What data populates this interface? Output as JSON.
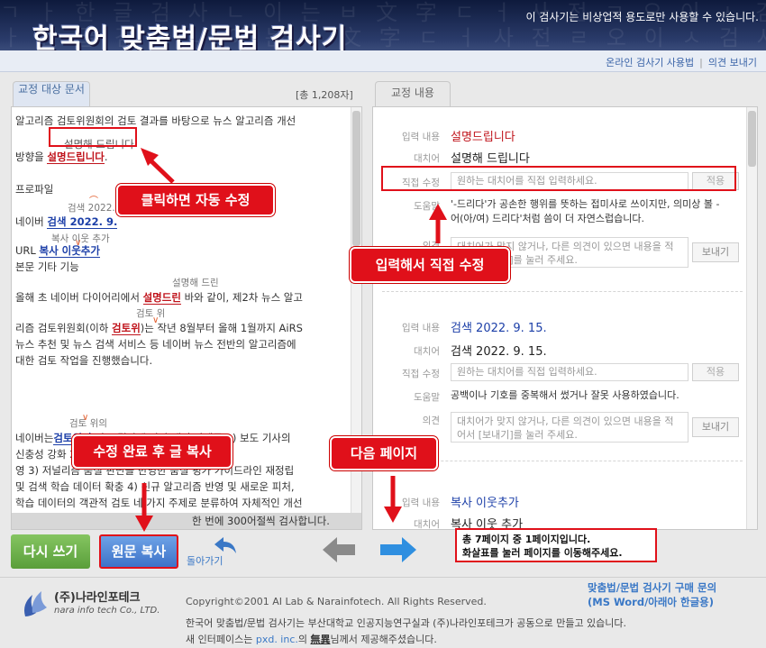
{
  "header": {
    "pattern_text": "ㄱ ㅏ 한 글 검 사 ㄴ 이 는 ㅂ 文 字 ㄷ ㅓ 사 전 ㄹ 오 이 ㅅ 검 사 ㅇ 교 정",
    "title": "한국어 맞춤법/문법 검사기",
    "notice": "이 검사기는 비상업적 용도로만 사용할 수 있습니다.",
    "links": [
      "온라인 검사기 사용법",
      "의견 보내기"
    ]
  },
  "left_panel": {
    "tab_label": "교정 대상 문서",
    "char_count": "[총 1,208자]",
    "bottom_message": "한 번에 300어절씩 검사합니다."
  },
  "right_panel": {
    "tab_label": "교정 내용"
  },
  "document": {
    "line1": "알고리즘 검토위원회의 검토 결과를 바탕으로 뉴스 알고리즘 개선",
    "sugg1": "설명해 드립니다",
    "line2_prefix": "방향을 ",
    "line2_err": "설명드립니다",
    "line2_suffix": ".",
    "line3": "프로파일",
    "sugg2": "검색 2022. 9. 15.",
    "line4_prefix": "네이버 ",
    "line4_err": "검색  2022. 9.",
    "sugg3": "복사 이웃 추가",
    "line5_prefix": "URL ",
    "line5_err": "복사  이웃추가",
    "line6": "본문 기타 기능",
    "sugg4": "설명해 드린",
    "line7_prefix": "올해 초 네이버 다이어리에서 ",
    "line7_err": "설명드린",
    "line7_suffix": " 바와 같이, 제2차 뉴스 알고",
    "sugg5": "검토 위",
    "line8_prefix": "리즘 검토위원회(이하 ",
    "line8_err": "검토위",
    "line8_suffix": ")는 작년 8월부터 올해 1월까지 AiRS",
    "line9": "뉴스 추천 및 뉴스 검색 서비스 등 네이버 뉴스 전반의 알고리즘에",
    "line10": "대한 검토 작업을 진행했습니다.",
    "sugg6": "검토 위의",
    "line11_prefix": "네이버는",
    "line11_err": "검토위의",
    "line11_suffix": " 검토 결과에 따라 개선 과제를 1) 보도 기사의",
    "line12": "신충성 강화 2) 다양한 관점 추천 및 다양한 관점",
    "line13": "영 3) 저널리즘 품질 판단을 반영한 품질 평가 가이드라인 재정립",
    "line14": "및 검색 학습 데이터 확충 4) 신규 알고리즘 반영 및 새로운 피처,",
    "line15": "학습 데이터의 객관적 검토 네 가지 주제로 분류하여 자체적인 개선"
  },
  "corrections": [
    {
      "input_label": "입력 내용",
      "input_value": "설명드립니다",
      "replace_label": "대치어",
      "replace_value": "설명해 드립니다",
      "direct_label": "직접 수정",
      "direct_placeholder": "원하는 대치어를 직접 입력하세요.",
      "apply_label": "적용",
      "help_label": "도움말",
      "help_text": "'-드리다'가 공손한 행위를 뜻하는 접미사로 쓰이지만, 의미상 볼 -어(아/여) 드리다'처럼 씀이 더 자연스럽습니다.",
      "opinion_label": "의견",
      "opinion_placeholder": "대치어가 맞지 않거나, 다른 의견이 있으면 내용을 적어서 [보내기]를 눌러 주세요.",
      "send_label": "보내기"
    },
    {
      "input_label": "입력 내용",
      "input_value": "검색 2022. 9. 15.",
      "replace_label": "대치어",
      "replace_value": "검색 2022. 9. 15.",
      "direct_label": "직접 수정",
      "direct_placeholder": "원하는 대치어를 직접 입력하세요.",
      "apply_label": "적용",
      "help_label": "도움말",
      "help_text": "공백이나 기호를 중복해서 썼거나 잘못 사용하였습니다.",
      "opinion_label": "의견",
      "opinion_placeholder": "대치어가 맞지 않거나, 다른 의견이 있으면 내용을 적어서 [보내기]를 눌러 주세요.",
      "send_label": "보내기"
    },
    {
      "input_label": "입력 내용",
      "input_value": "복사 이웃추가",
      "replace_label": "대치어",
      "replace_value": "복사 이웃 추가"
    }
  ],
  "controls": {
    "rewrite_label": "다시 쓰기",
    "copy_label": "원문 복사",
    "back_label": "돌아가기",
    "page_info_line1": "총 7페이지 중 1페이지입니다.",
    "page_info_line2": "화살표를 눌러 페이지를 이동해주세요."
  },
  "callouts": {
    "click_auto": "클릭하면 자동 수정",
    "input_direct": "입력해서 직접 수정",
    "copy_after": "수정 완료 후 글 복사",
    "next_page": "다음 페이지"
  },
  "footer": {
    "logo_name": "(주)나라인포테크",
    "logo_eng": "nara info tech Co., LTD.",
    "purchase_line1": "맞춤법/문법 검사기 구매 문의",
    "purchase_line2": "(MS Word/아래아 한글용)",
    "copyright": "Copyright©2001 AI Lab & Narainfotech. All Rights Reserved.",
    "description": "한국어 맞춤법/문법 검사기는 부산대학교 인공지능연구실과 (주)나라인포테크가 공동으로 만들고 있습니다.",
    "credit_prefix": "새 인터페이스는 ",
    "credit_link": "pxd. inc.",
    "credit_mid": "의 ",
    "credit_strong": "無異",
    "credit_suffix": "님께서 제공해주셨습니다."
  },
  "colors": {
    "error_red": "#c0141c",
    "error_blue": "#1c3fa8",
    "callout_red": "#e0101a",
    "rewrite_green": "#6aae46",
    "copy_blue": "#4a80d0",
    "link_blue": "#3a78c6"
  }
}
